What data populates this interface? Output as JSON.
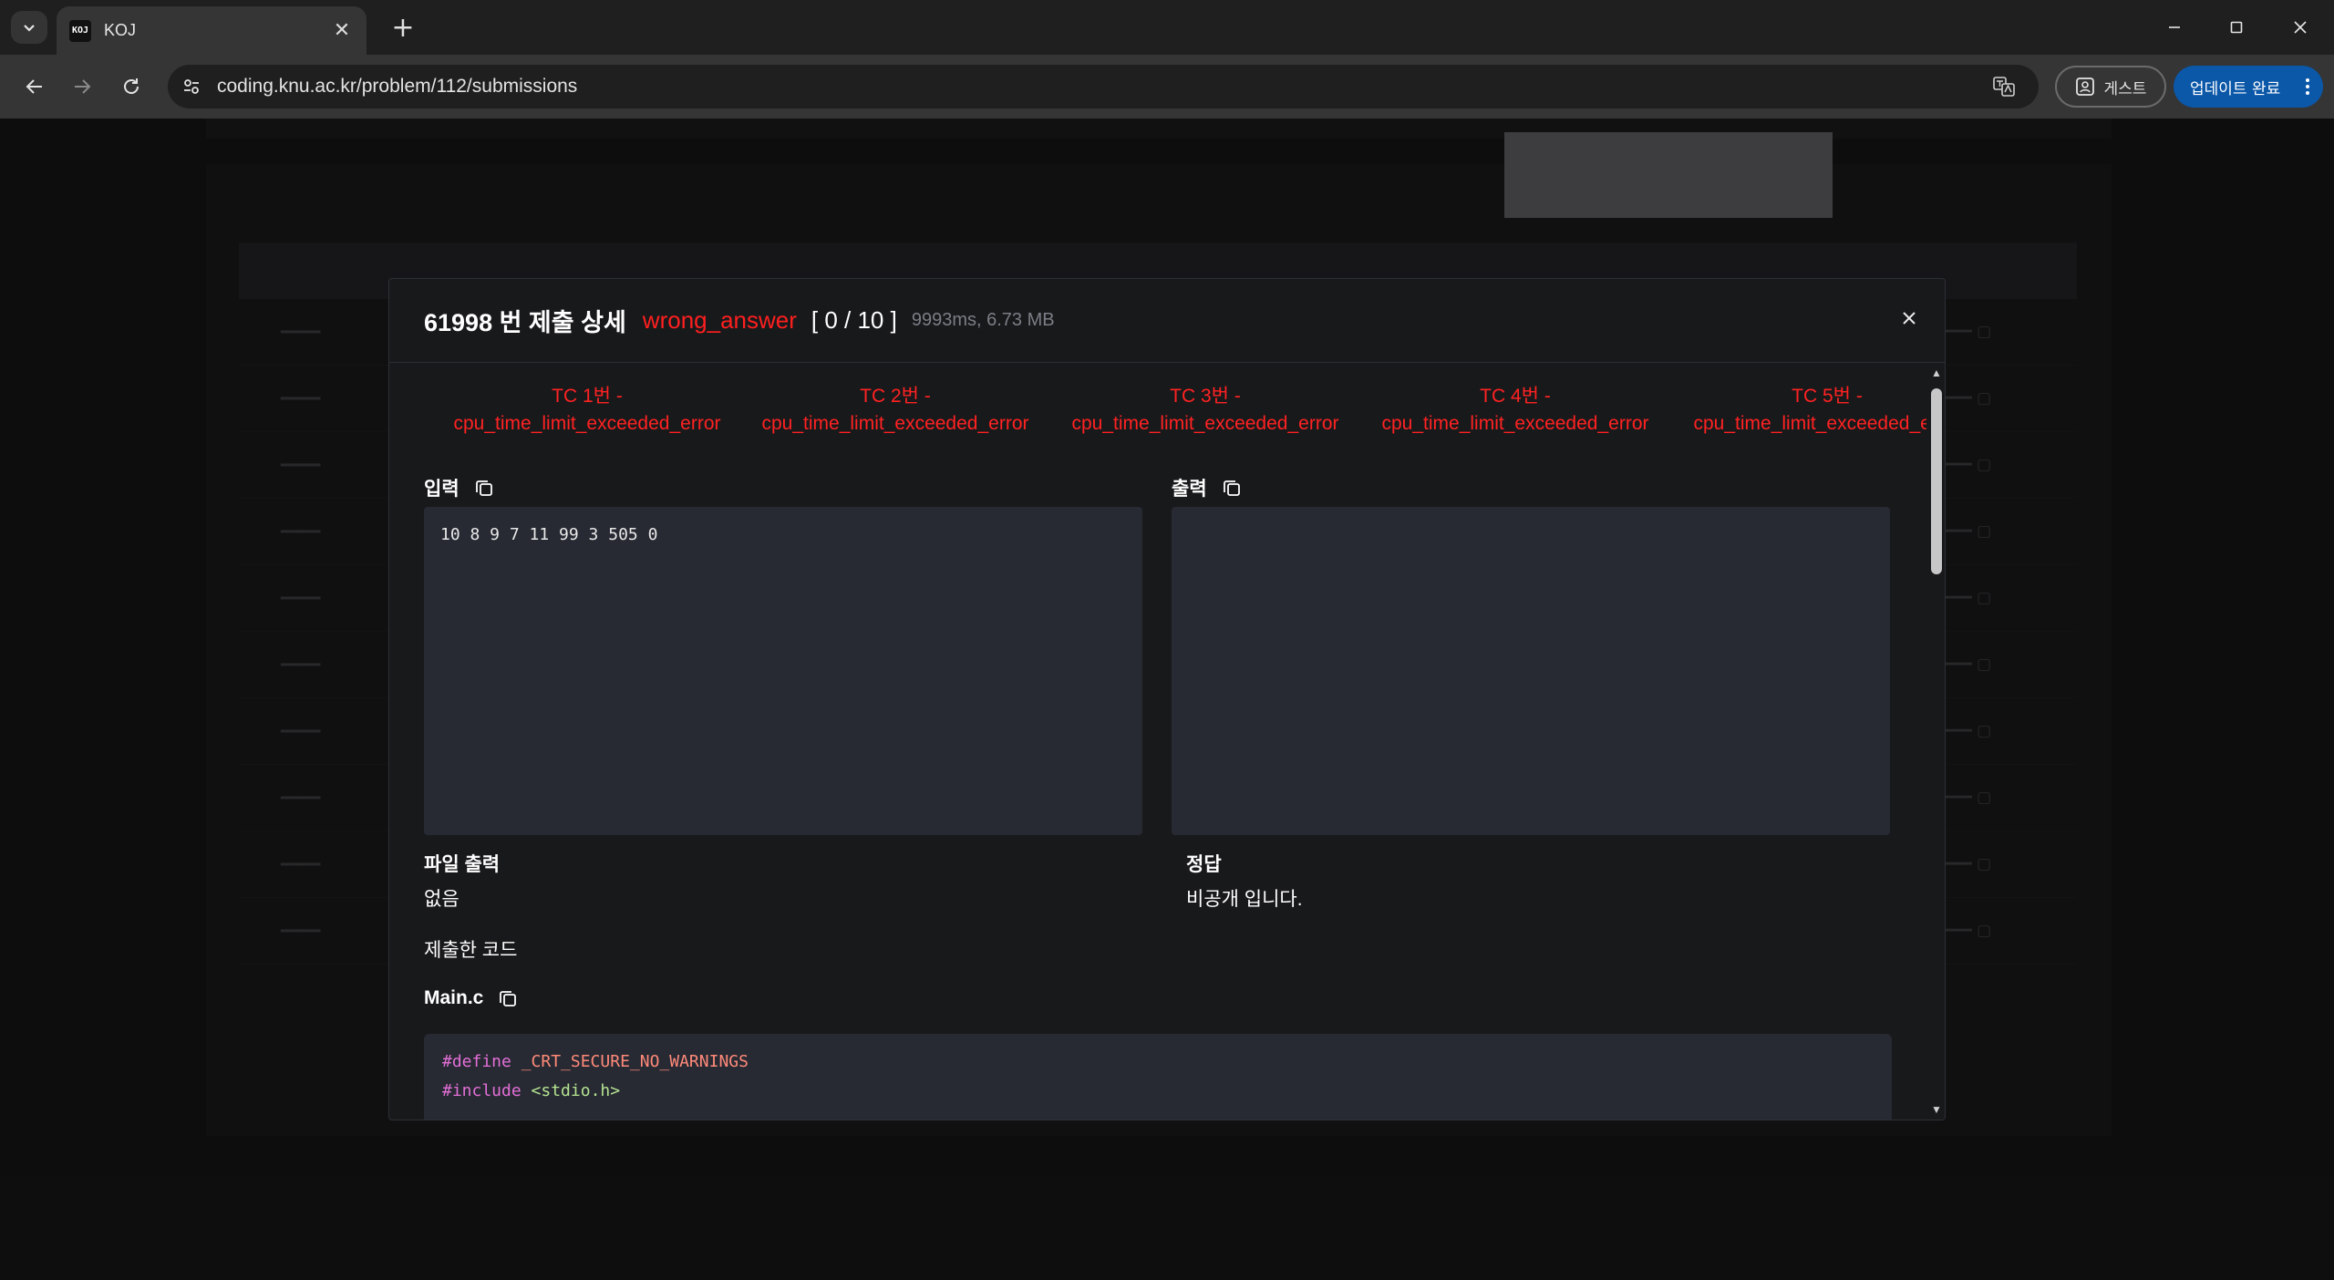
{
  "browser": {
    "tab_title": "KOJ",
    "favicon_text": "KOJ",
    "url": "coding.knu.ac.kr/problem/112/submissions",
    "guest_label": "게스트",
    "update_label": "업데이트 완료"
  },
  "modal": {
    "title": "61998 번 제출 상세",
    "verdict": "wrong_answer",
    "score": "[ 0 / 10 ]",
    "stats": "9993ms, 6.73 MB",
    "testcases": [
      {
        "name": "TC 1번 -",
        "status": "cpu_time_limit_exceeded_error"
      },
      {
        "name": "TC 2번 -",
        "status": "cpu_time_limit_exceeded_error"
      },
      {
        "name": "TC 3번 -",
        "status": "cpu_time_limit_exceeded_error"
      },
      {
        "name": "TC 4번 -",
        "status": "cpu_time_limit_exceeded_error"
      },
      {
        "name": "TC 5번 -",
        "status": "cpu_time_limit_exceeded_error"
      }
    ],
    "input_label": "입력",
    "input_value": "10 8 9 7 11 99 3 505 0",
    "output_label": "출력",
    "output_value": "",
    "file_output_label": "파일 출력",
    "file_output_value": "없음",
    "answer_label": "정답",
    "answer_value": "비공개 입니다.",
    "submitted_code_label": "제출한 코드",
    "file_name": "Main.c",
    "code": {
      "line1_directive": "#define",
      "line1_ident": "_CRT_SECURE_NO_WARNINGS",
      "line2_directive": "#include",
      "line2_header": "<stdio.h>"
    }
  },
  "colors": {
    "verdict": "#ff1f1f",
    "testcase_error": "#ff2222",
    "modal_bg": "#18191b",
    "box_bg": "#272a33",
    "update_button": "#0b57a8"
  }
}
